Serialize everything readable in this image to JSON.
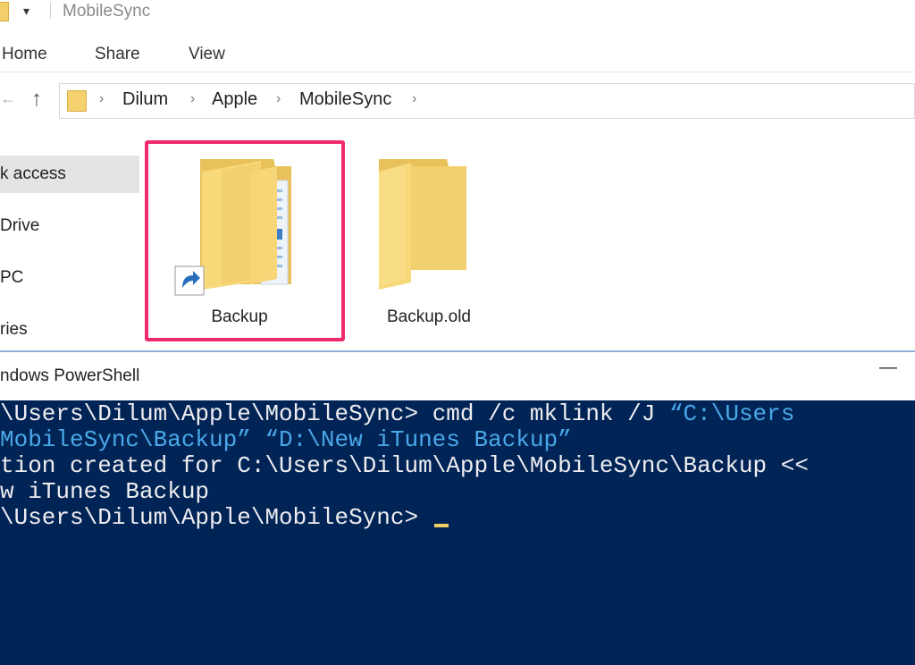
{
  "window": {
    "title": "MobileSync"
  },
  "ribbon": {
    "tabs": [
      "Home",
      "Share",
      "View"
    ]
  },
  "address": {
    "crumbs": [
      "Dilum",
      "Apple",
      "MobileSync"
    ]
  },
  "sidebar": {
    "items": [
      "k access",
      "Drive",
      "PC",
      "ries"
    ]
  },
  "files": [
    {
      "name": "Backup",
      "type": "folder-shortcut",
      "highlighted": true
    },
    {
      "name": "Backup.old",
      "type": "folder",
      "highlighted": false
    }
  ],
  "powershell": {
    "title": "ndows PowerShell",
    "lines": {
      "l1_prompt": "\\Users\\Dilum\\Apple\\MobileSync> ",
      "l1_cmd": "cmd /c mklink /J ",
      "l1_str": "“C:\\Users",
      "l2_str": "MobileSync\\Backup” “D:\\New iTunes Backup”",
      "l3": "tion created for C:\\Users\\Dilum\\Apple\\MobileSync\\Backup <<",
      "l4": "w iTunes Backup",
      "l5_prompt": "\\Users\\Dilum\\Apple\\MobileSync> "
    }
  },
  "colors": {
    "console_bg": "#012456",
    "console_text": "#eeedf0",
    "string_text": "#4aa8e8",
    "highlight_border": "#ef2b6b"
  }
}
